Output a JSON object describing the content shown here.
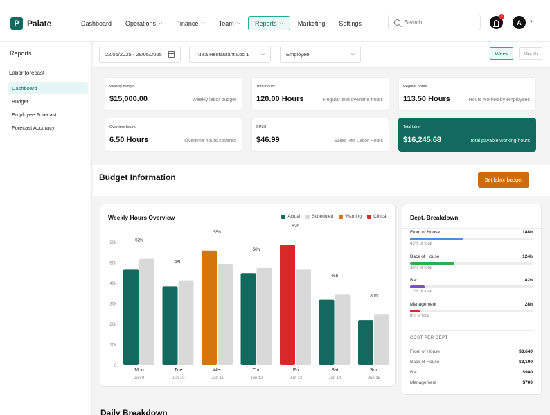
{
  "app": {
    "logo_letter": "P",
    "name": "Palate"
  },
  "nav": {
    "items": [
      {
        "label": "Dashboard",
        "chevron": false,
        "active": false
      },
      {
        "label": "Operations",
        "chevron": true,
        "active": false
      },
      {
        "label": "Finance",
        "chevron": true,
        "active": false
      },
      {
        "label": "Team",
        "chevron": true,
        "active": false
      },
      {
        "label": "Reports",
        "chevron": true,
        "active": true
      },
      {
        "label": "Marketing",
        "chevron": false,
        "active": false
      },
      {
        "label": "Settings",
        "chevron": false,
        "active": false
      }
    ],
    "search_placeholder": "Search",
    "notification_count": "1",
    "avatar_initial": "A"
  },
  "sidebar": {
    "title": "Reports",
    "section": "Labor forecast",
    "items": [
      {
        "label": "Dashboard",
        "active": true
      },
      {
        "label": "Budget",
        "active": false
      },
      {
        "label": "Employee Forecast",
        "active": false
      },
      {
        "label": "Forecast Accuracy",
        "active": false
      }
    ]
  },
  "filters": {
    "date_range": "22/05/2025 - 28/05/2025",
    "location": "Tulsa Restaurant Loc 1",
    "group_by": "Employee",
    "views": [
      "Week",
      "Month"
    ],
    "active_view": "Week"
  },
  "stats": [
    {
      "label": "Weekly budget",
      "value": "$15,000.00",
      "desc": "Weekly labor budget",
      "highlight": false
    },
    {
      "label": "Total hours",
      "value": "120.00 Hours",
      "desc": "Regular and overtime hours",
      "highlight": false
    },
    {
      "label": "Regular hours",
      "value": "113.50 Hours",
      "desc": "Hours worked by employees",
      "highlight": false
    },
    {
      "label": "Overtime hours",
      "value": "6.50 Hours",
      "desc": "Overtime hours covered",
      "highlight": false
    },
    {
      "label": "SPLH",
      "value": "$46.99",
      "desc": "Sales Per Labor Hours",
      "highlight": false
    },
    {
      "label": "Total labor",
      "value": "$16,245.68",
      "desc": "Total payable working hours",
      "highlight": true
    }
  ],
  "budget_section": {
    "title": "Budget Information",
    "button_label": "Set labor budget"
  },
  "weekly_chart": {
    "title": "Weekly Hours Overview"
  },
  "chart_data": {
    "type": "bar",
    "categories": [
      "Mon",
      "Tue",
      "Wed",
      "Thu",
      "Fri",
      "Sat",
      "Sun"
    ],
    "dates": [
      "Jun 9",
      "Jun 10",
      "Jun 11",
      "Jun 12",
      "Jun 13",
      "Jun 14",
      "Jun 15"
    ],
    "value_labels": [
      "52h",
      "48h",
      "55h",
      "50h",
      "62h",
      "45h",
      "30h"
    ],
    "actual_status": [
      "Actual",
      "Actual",
      "Warning",
      "Actual",
      "Critical",
      "Actual",
      "Actual"
    ],
    "series": [
      {
        "name": "Actual",
        "values": [
          47,
          38.5,
          56,
          45,
          59,
          32,
          22
        ]
      },
      {
        "name": "Scheduled",
        "values": [
          52,
          41.5,
          49.5,
          47.5,
          47,
          34.5,
          25
        ]
      }
    ],
    "legend": [
      "Actual",
      "Scheduled",
      "Warning",
      "Critical"
    ],
    "colors": {
      "Actual": "#14695f",
      "Scheduled": "#d9d9d9",
      "Warning": "#d4760b",
      "Critical": "#d8282a"
    },
    "yticks": [
      "0",
      "10k",
      "20k",
      "30k",
      "40k",
      "50k",
      "60k"
    ],
    "ylim": [
      0,
      60
    ],
    "xlabel": "",
    "ylabel": "",
    "grid": false,
    "legend_position": "top-right"
  },
  "dept": {
    "title": "Dept. Breakdown",
    "items": [
      {
        "name": "Front of House",
        "hours": "148h",
        "pct_label": "43% of total",
        "pct": 0.43,
        "color": "#4a8fd9"
      },
      {
        "name": "Back of House",
        "hours": "124h",
        "pct_label": "36% of total",
        "pct": 0.36,
        "color": "#2fae4f"
      },
      {
        "name": "Bar",
        "hours": "42h",
        "pct_label": "12% of total",
        "pct": 0.12,
        "color": "#7b4fd0"
      },
      {
        "name": "Management",
        "hours": "28h",
        "pct_label": "8% of total",
        "pct": 0.08,
        "color": "#d8282a"
      }
    ],
    "cost_title": "COST PER DEPT",
    "costs": [
      {
        "name": "Front of House",
        "value": "$3,640"
      },
      {
        "name": "Back of House",
        "value": "$3,100"
      },
      {
        "name": "Bar",
        "value": "$980"
      },
      {
        "name": "Management",
        "value": "$700"
      }
    ]
  },
  "daily": {
    "title": "Daily Breakdown"
  }
}
